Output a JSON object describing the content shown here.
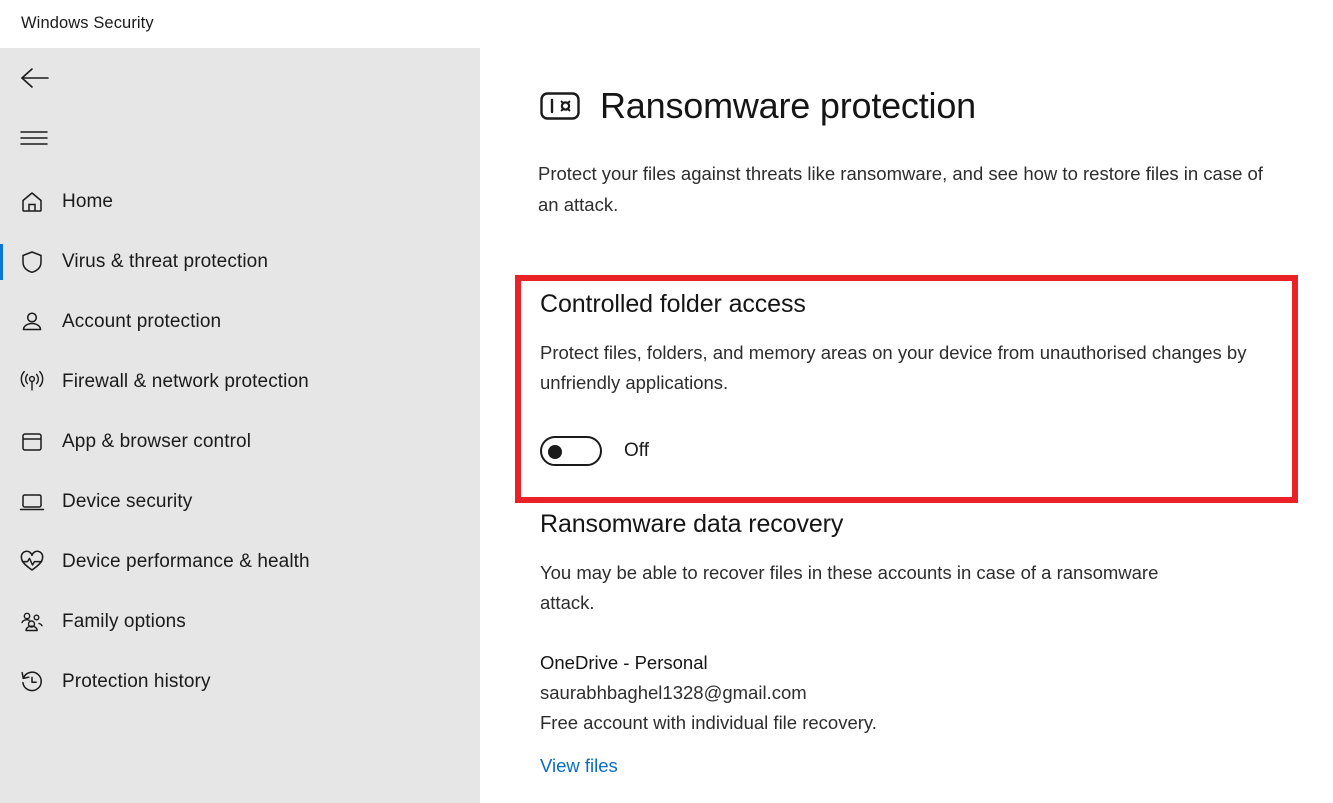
{
  "window": {
    "title": "Windows Security"
  },
  "sidebar": {
    "back_label": "Back",
    "menu_label": "Navigation menu",
    "items": [
      {
        "label": "Home",
        "icon": "home-icon",
        "selected": false
      },
      {
        "label": "Virus & threat protection",
        "icon": "shield-icon",
        "selected": true
      },
      {
        "label": "Account protection",
        "icon": "person-icon",
        "selected": false
      },
      {
        "label": "Firewall & network protection",
        "icon": "wifi-signal-icon",
        "selected": false
      },
      {
        "label": "App & browser control",
        "icon": "browser-window-icon",
        "selected": false
      },
      {
        "label": "Device security",
        "icon": "laptop-icon",
        "selected": false
      },
      {
        "label": "Device performance & health",
        "icon": "heart-pulse-icon",
        "selected": false
      },
      {
        "label": "Family options",
        "icon": "people-group-icon",
        "selected": false
      },
      {
        "label": "Protection history",
        "icon": "clock-history-icon",
        "selected": false
      }
    ]
  },
  "main": {
    "page_icon": "ransomware-shield-icon",
    "page_title": "Ransomware protection",
    "page_description": "Protect your files against threats like ransomware, and see how to restore files in case of an attack.",
    "controlled_folder_access": {
      "title": "Controlled folder access",
      "description": "Protect files, folders, and memory areas on your device from unauthorised changes by unfriendly applications.",
      "toggle_state": "Off",
      "toggle_on": false
    },
    "data_recovery": {
      "title": "Ransomware data recovery",
      "description": "You may be able to recover files in these accounts in case of a ransomware attack.",
      "account_name": "OneDrive - Personal",
      "account_email": "saurabhbaghel1328@gmail.com",
      "account_note": "Free account with individual file recovery.",
      "link_label": "View files"
    }
  },
  "annotation": {
    "highlight_color": "#ea2127",
    "target": "controlled-folder-access"
  },
  "colors": {
    "accent_blue": "#0a78d4",
    "link_blue": "#0a6cc4",
    "sidebar_bg": "#e6e6e6",
    "highlight_red": "#ea2127"
  }
}
